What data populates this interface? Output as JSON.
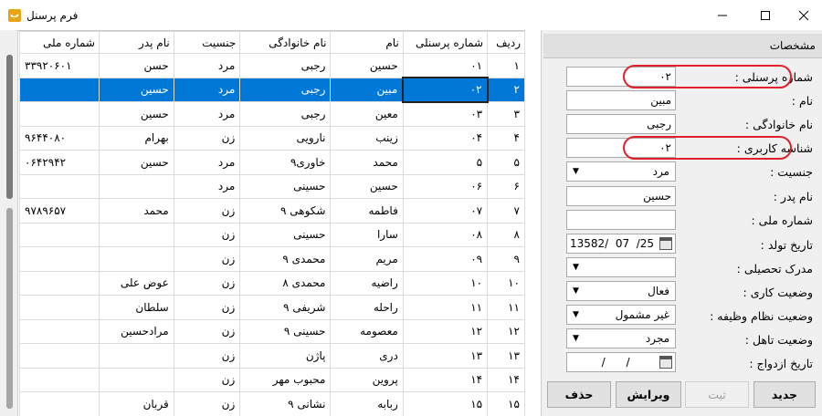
{
  "window": {
    "title": "فرم پرسنل",
    "icon": "app-icon"
  },
  "grid": {
    "columns": [
      "ردیف",
      "شماره پرسنلی",
      "نام",
      "نام خانوادگی",
      "جنسیت",
      "نام پدر",
      "شماره ملی"
    ],
    "rows": [
      [
        "١",
        "٠١",
        "حسین",
        "رجبی",
        "مرد",
        "حسن",
        "٣٣٩٢٠۶٠١"
      ],
      [
        "٢",
        "٠٢",
        "مبین",
        "رجبی",
        "مرد",
        "حسین",
        ""
      ],
      [
        "٣",
        "٠٣",
        "معین",
        "رجبی",
        "مرد",
        "حسین",
        ""
      ],
      [
        "۴",
        "٠۴",
        "زینب",
        "نارویی",
        "زن",
        "بهرام",
        "٩۶۴۴٠٨٠"
      ],
      [
        "۵",
        "۵",
        "محمد",
        "خاوری٩",
        "مرد",
        "حسین",
        "٠۶۴٢٩۴٢"
      ],
      [
        "۶",
        "٠۶",
        "حسین",
        "حسینی",
        "مرد",
        "",
        ""
      ],
      [
        "٧",
        "٠٧",
        "فاطمه",
        "شکوهی ٩",
        "زن",
        "محمد",
        "٩٧٨٩۶۵٧"
      ],
      [
        "٨",
        "٠٨",
        "سارا",
        "حسینی",
        "زن",
        "",
        ""
      ],
      [
        "٩",
        "٠٩",
        "مریم",
        "محمدی ٩",
        "زن",
        "",
        ""
      ],
      [
        "١٠",
        "١٠",
        "راضیه",
        "محمدی ٨",
        "زن",
        "عوض علی",
        ""
      ],
      [
        "١١",
        "١١",
        "راحله",
        "شریفی ٩",
        "زن",
        "سلطان",
        ""
      ],
      [
        "١٢",
        "١٢",
        "معصومه",
        "حسینی ٩",
        "زن",
        "مرادحسین",
        ""
      ],
      [
        "١٣",
        "١٣",
        "دری",
        "پاژن",
        "زن",
        "",
        ""
      ],
      [
        "١۴",
        "١۴",
        "پروین",
        "محبوب مهر",
        "زن",
        "",
        ""
      ],
      [
        "١۵",
        "١۵",
        "ربابه",
        "نشانی ٩",
        "زن",
        "قربان",
        ""
      ]
    ],
    "selected_row": 1
  },
  "panel": {
    "header": "مشخصات",
    "fields": {
      "personnel_no": {
        "label": "شماره پرسنلی :",
        "value": "٠٢"
      },
      "first_name": {
        "label": "نام :",
        "value": "مبین"
      },
      "last_name": {
        "label": "نام خانوادگی :",
        "value": "رجبی"
      },
      "user_id": {
        "label": "شناسه کاربری :",
        "value": "٠٢"
      },
      "gender": {
        "label": "جنسیت :",
        "value": "مرد"
      },
      "father_name": {
        "label": "نام پدر :",
        "value": "حسین"
      },
      "national_id": {
        "label": "شماره ملی :",
        "value": ""
      },
      "birth_date": {
        "label": "تاریخ تولد :",
        "value": "13582/  07  /25"
      },
      "education": {
        "label": "مدرک تحصیلی :",
        "value": ""
      },
      "work_status": {
        "label": "وضعیت کاری :",
        "value": "فعال"
      },
      "duty_status": {
        "label": "وضعیت نظام وظیفه :",
        "value": "غیر مشمول"
      },
      "marital_status": {
        "label": "وضعیت تاهل :",
        "value": "مجرد"
      },
      "marriage_date": {
        "label": "تاریخ ازدواج :",
        "value": "  /      /"
      }
    },
    "buttons": {
      "new": "جدید",
      "save": "ثبت",
      "edit": "ویرایش",
      "delete": "حذف"
    }
  },
  "colors": {
    "selection": "#0078d7",
    "highlight_oval": "#e0202a",
    "panel_bg": "#f0f0f0"
  }
}
